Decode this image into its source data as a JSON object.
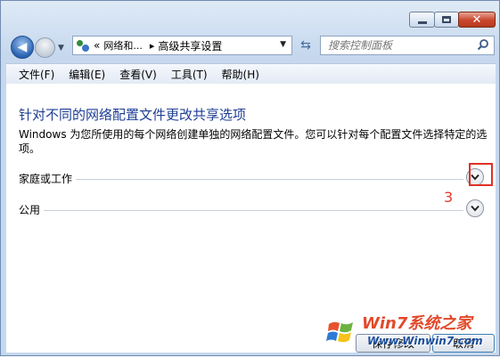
{
  "window": {
    "controls": [
      "minimize-button",
      "maximize-button",
      "close-button"
    ]
  },
  "navigation": {
    "back_icon": "back-arrow-icon",
    "forward_icon": "forward-arrow-icon",
    "address": {
      "prefix": "«",
      "crumb1": "网络和...",
      "separator": "▸",
      "crumb2": "高级共享设置"
    },
    "search_placeholder": "搜索控制面板"
  },
  "menu": {
    "items": [
      "文件(F)",
      "编辑(E)",
      "查看(V)",
      "工具(T)",
      "帮助(H)"
    ]
  },
  "main": {
    "title": "针对不同的网络配置文件更改共享选项",
    "description": "Windows 为您所使用的每个网络创建单独的网络配置文件。您可以针对每个配置文件选择特定的选项。",
    "sections": [
      {
        "label": "家庭或工作"
      },
      {
        "label": "公用"
      }
    ],
    "annotation": "3"
  },
  "buttons": {
    "save": "保存修改",
    "cancel": "取消"
  },
  "watermark": {
    "brand": "Win7系统之家",
    "url": "Www.Winwin7.com"
  },
  "colors": {
    "title": "#1e3e94",
    "highlight": "#e03126",
    "annotation": "#e23c2f"
  }
}
